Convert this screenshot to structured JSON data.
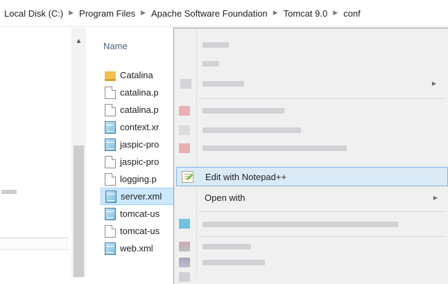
{
  "address_bar": {
    "crumbs": [
      "Local Disk (C:)",
      "Program Files",
      "Apache Software Foundation",
      "Tomcat 9.0",
      "conf"
    ],
    "separator_icon": "triangle-right-icon"
  },
  "nav_pane": {
    "scroll_up_icon": "chevron-up-icon"
  },
  "file_list": {
    "column_name": "Name",
    "files": [
      {
        "name": "Catalina",
        "icon": "folder-icon"
      },
      {
        "name": "catalina.p",
        "icon": "document-icon"
      },
      {
        "name": "catalina.p",
        "icon": "document-icon"
      },
      {
        "name": "context.xr",
        "icon": "xml-file-icon"
      },
      {
        "name": "jaspic-pro",
        "icon": "xml-file-icon"
      },
      {
        "name": "jaspic-pro",
        "icon": "document-icon"
      },
      {
        "name": "logging.p",
        "icon": "document-icon"
      },
      {
        "name": "server.xml",
        "icon": "xml-file-icon",
        "selected": true
      },
      {
        "name": "tomcat-us",
        "icon": "xml-file-icon"
      },
      {
        "name": "tomcat-us",
        "icon": "document-icon"
      },
      {
        "name": "web.xml",
        "icon": "xml-file-icon"
      }
    ]
  },
  "context_menu": {
    "edit_with_notepad": "Edit with Notepad++",
    "open_with": "Open with",
    "submenu_arrow": "▶",
    "colors": {
      "highlight_bg": "#dbeaf7",
      "highlight_border": "#7eb4ea",
      "menu_bg": "#f0f0f0"
    }
  }
}
